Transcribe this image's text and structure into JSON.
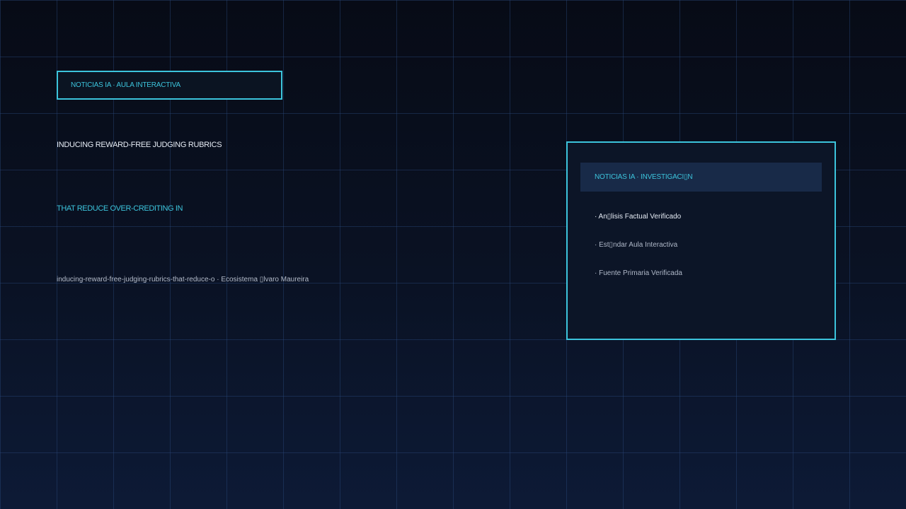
{
  "tag": {
    "label": "NOTICIAS IA · AULA INTERACTIVA"
  },
  "headline": {
    "line1": "INDUCING REWARD-FREE JUDGING RUBRICS",
    "line2": "THAT REDUCE OVER-CREDITING IN"
  },
  "slug": "inducing-reward-free-judging-rubrics-that-reduce-o · Ecosistema ▯lvaro Maureira",
  "panel": {
    "header": "NOTICIAS IA · INVESTIGACI▯N",
    "items": [
      "· An▯lisis Factual Verificado",
      "· Est▯ndar Aula Interactiva",
      "· Fuente Primaria Verificada"
    ]
  },
  "colors": {
    "accent": "#3cc4dc",
    "background_top": "#070b16",
    "background_bottom": "#0d1a36",
    "panel_header_bg": "#182a48"
  }
}
